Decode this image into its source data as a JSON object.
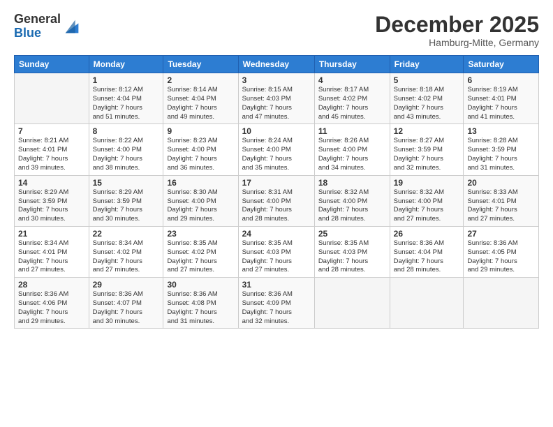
{
  "logo": {
    "general": "General",
    "blue": "Blue"
  },
  "title": "December 2025",
  "subtitle": "Hamburg-Mitte, Germany",
  "days_header": [
    "Sunday",
    "Monday",
    "Tuesday",
    "Wednesday",
    "Thursday",
    "Friday",
    "Saturday"
  ],
  "weeks": [
    [
      {
        "day": "",
        "info": ""
      },
      {
        "day": "1",
        "info": "Sunrise: 8:12 AM\nSunset: 4:04 PM\nDaylight: 7 hours\nand 51 minutes."
      },
      {
        "day": "2",
        "info": "Sunrise: 8:14 AM\nSunset: 4:04 PM\nDaylight: 7 hours\nand 49 minutes."
      },
      {
        "day": "3",
        "info": "Sunrise: 8:15 AM\nSunset: 4:03 PM\nDaylight: 7 hours\nand 47 minutes."
      },
      {
        "day": "4",
        "info": "Sunrise: 8:17 AM\nSunset: 4:02 PM\nDaylight: 7 hours\nand 45 minutes."
      },
      {
        "day": "5",
        "info": "Sunrise: 8:18 AM\nSunset: 4:02 PM\nDaylight: 7 hours\nand 43 minutes."
      },
      {
        "day": "6",
        "info": "Sunrise: 8:19 AM\nSunset: 4:01 PM\nDaylight: 7 hours\nand 41 minutes."
      }
    ],
    [
      {
        "day": "7",
        "info": "Sunrise: 8:21 AM\nSunset: 4:01 PM\nDaylight: 7 hours\nand 39 minutes."
      },
      {
        "day": "8",
        "info": "Sunrise: 8:22 AM\nSunset: 4:00 PM\nDaylight: 7 hours\nand 38 minutes."
      },
      {
        "day": "9",
        "info": "Sunrise: 8:23 AM\nSunset: 4:00 PM\nDaylight: 7 hours\nand 36 minutes."
      },
      {
        "day": "10",
        "info": "Sunrise: 8:24 AM\nSunset: 4:00 PM\nDaylight: 7 hours\nand 35 minutes."
      },
      {
        "day": "11",
        "info": "Sunrise: 8:26 AM\nSunset: 4:00 PM\nDaylight: 7 hours\nand 34 minutes."
      },
      {
        "day": "12",
        "info": "Sunrise: 8:27 AM\nSunset: 3:59 PM\nDaylight: 7 hours\nand 32 minutes."
      },
      {
        "day": "13",
        "info": "Sunrise: 8:28 AM\nSunset: 3:59 PM\nDaylight: 7 hours\nand 31 minutes."
      }
    ],
    [
      {
        "day": "14",
        "info": "Sunrise: 8:29 AM\nSunset: 3:59 PM\nDaylight: 7 hours\nand 30 minutes."
      },
      {
        "day": "15",
        "info": "Sunrise: 8:29 AM\nSunset: 3:59 PM\nDaylight: 7 hours\nand 30 minutes."
      },
      {
        "day": "16",
        "info": "Sunrise: 8:30 AM\nSunset: 4:00 PM\nDaylight: 7 hours\nand 29 minutes."
      },
      {
        "day": "17",
        "info": "Sunrise: 8:31 AM\nSunset: 4:00 PM\nDaylight: 7 hours\nand 28 minutes."
      },
      {
        "day": "18",
        "info": "Sunrise: 8:32 AM\nSunset: 4:00 PM\nDaylight: 7 hours\nand 28 minutes."
      },
      {
        "day": "19",
        "info": "Sunrise: 8:32 AM\nSunset: 4:00 PM\nDaylight: 7 hours\nand 27 minutes."
      },
      {
        "day": "20",
        "info": "Sunrise: 8:33 AM\nSunset: 4:01 PM\nDaylight: 7 hours\nand 27 minutes."
      }
    ],
    [
      {
        "day": "21",
        "info": "Sunrise: 8:34 AM\nSunset: 4:01 PM\nDaylight: 7 hours\nand 27 minutes."
      },
      {
        "day": "22",
        "info": "Sunrise: 8:34 AM\nSunset: 4:02 PM\nDaylight: 7 hours\nand 27 minutes."
      },
      {
        "day": "23",
        "info": "Sunrise: 8:35 AM\nSunset: 4:02 PM\nDaylight: 7 hours\nand 27 minutes."
      },
      {
        "day": "24",
        "info": "Sunrise: 8:35 AM\nSunset: 4:03 PM\nDaylight: 7 hours\nand 27 minutes."
      },
      {
        "day": "25",
        "info": "Sunrise: 8:35 AM\nSunset: 4:03 PM\nDaylight: 7 hours\nand 28 minutes."
      },
      {
        "day": "26",
        "info": "Sunrise: 8:36 AM\nSunset: 4:04 PM\nDaylight: 7 hours\nand 28 minutes."
      },
      {
        "day": "27",
        "info": "Sunrise: 8:36 AM\nSunset: 4:05 PM\nDaylight: 7 hours\nand 29 minutes."
      }
    ],
    [
      {
        "day": "28",
        "info": "Sunrise: 8:36 AM\nSunset: 4:06 PM\nDaylight: 7 hours\nand 29 minutes."
      },
      {
        "day": "29",
        "info": "Sunrise: 8:36 AM\nSunset: 4:07 PM\nDaylight: 7 hours\nand 30 minutes."
      },
      {
        "day": "30",
        "info": "Sunrise: 8:36 AM\nSunset: 4:08 PM\nDaylight: 7 hours\nand 31 minutes."
      },
      {
        "day": "31",
        "info": "Sunrise: 8:36 AM\nSunset: 4:09 PM\nDaylight: 7 hours\nand 32 minutes."
      },
      {
        "day": "",
        "info": ""
      },
      {
        "day": "",
        "info": ""
      },
      {
        "day": "",
        "info": ""
      }
    ]
  ]
}
